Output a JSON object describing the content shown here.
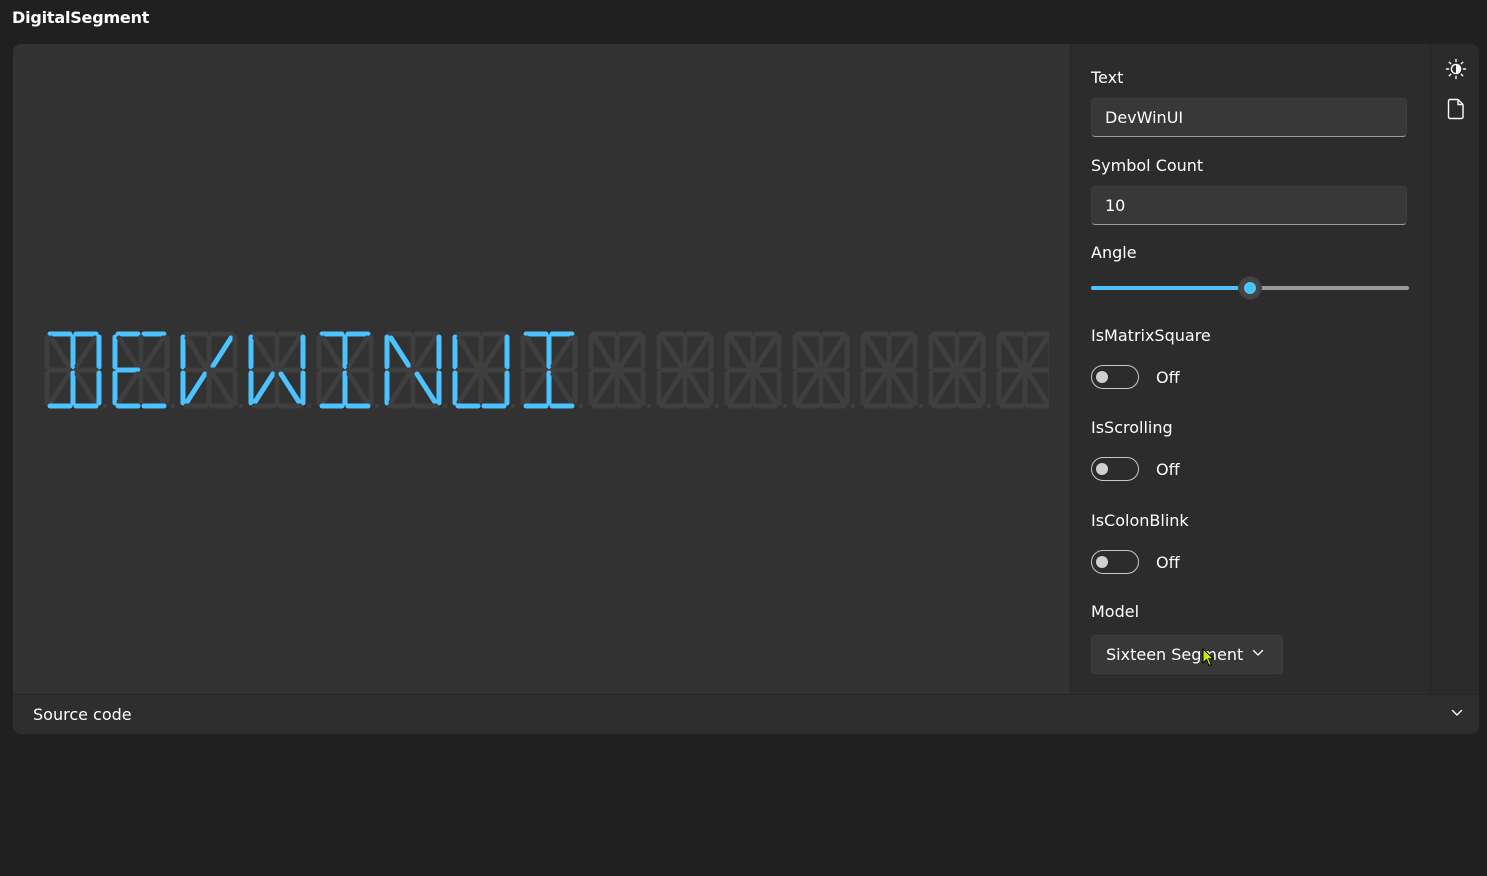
{
  "window": {
    "title": "DigitalSegment"
  },
  "display": {
    "text": "DEVWINUI",
    "symbol_count": 15,
    "on_color": "#4cc2ff",
    "off_color": "#3f3f3f",
    "model": "sixteen-segment"
  },
  "options": {
    "text_label": "Text",
    "text_value": "DevWinUI",
    "symbol_count_label": "Symbol Count",
    "symbol_count_value": "10",
    "angle_label": "Angle",
    "angle_fraction": 0.5,
    "matrix_label": "IsMatrixSquare",
    "matrix_state": "Off",
    "scrolling_label": "IsScrolling",
    "scrolling_state": "Off",
    "colon_label": "IsColonBlink",
    "colon_state": "Off",
    "model_label": "Model",
    "model_value": "Sixteen Segment"
  },
  "toolbar": {
    "icons": [
      "theme-toggle-icon",
      "document-icon"
    ]
  },
  "source": {
    "label": "Source code"
  },
  "colors": {
    "accent": "#4cc2ff",
    "background": "#202020",
    "card": "#2b2b2b"
  }
}
